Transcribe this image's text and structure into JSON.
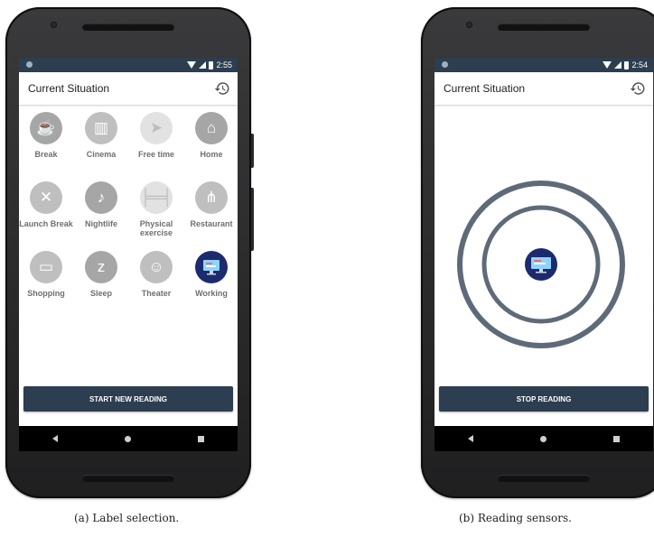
{
  "colors": {
    "primary": "#2c3e50",
    "working_badge": "#1c2a6e",
    "ring": "#5f6a79"
  },
  "panel_a": {
    "status_time": "2:55",
    "title": "Current Situation",
    "history_icon": "history-icon",
    "categories": [
      {
        "label": "Break",
        "icon": "coffee-icon"
      },
      {
        "label": "Cinema",
        "icon": "popcorn-icon"
      },
      {
        "label": "Free time",
        "icon": "paper-plane-icon"
      },
      {
        "label": "Home",
        "icon": "house-icon"
      },
      {
        "label": "Launch Break",
        "icon": "cutlery-icon"
      },
      {
        "label": "Nightlife",
        "icon": "dancer-icon"
      },
      {
        "label": "Physical exercise",
        "icon": "dumbbell-icon"
      },
      {
        "label": "Restaurant",
        "icon": "utensils-icon"
      },
      {
        "label": "Shopping",
        "icon": "card-icon"
      },
      {
        "label": "Sleep",
        "icon": "sleep-icon"
      },
      {
        "label": "Theater",
        "icon": "masks-icon"
      },
      {
        "label": "Working",
        "icon": "monitor-icon",
        "selected": true
      }
    ],
    "button": "START NEW READING",
    "caption": "(a) Label selection."
  },
  "panel_b": {
    "status_time": "2:54",
    "title": "Current Situation",
    "history_icon": "history-icon",
    "center_icon": "monitor-icon",
    "button": "STOP READING",
    "caption": "(b) Reading sensors."
  }
}
